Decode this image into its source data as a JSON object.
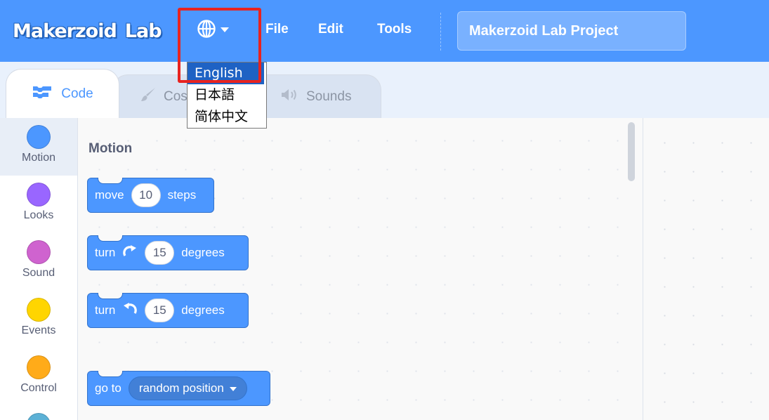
{
  "menubar": {
    "logo_text": "Makerzoid Lab",
    "logo_part1": "Makerzoid",
    "logo_part2": "Lab",
    "language_icon": "globe-icon",
    "file_label": "File",
    "edit_label": "Edit",
    "tools_label": "Tools",
    "project_title": "Makerzoid Lab Project"
  },
  "language_menu": {
    "options": [
      "English",
      "日本語",
      "简体中文"
    ],
    "selected": "English"
  },
  "tabs": [
    {
      "label": "Code",
      "icon": "code-blocks-icon",
      "active": true
    },
    {
      "label": "Costumes",
      "icon": "paintbrush-icon",
      "active": false
    },
    {
      "label": "Sounds",
      "icon": "speaker-icon",
      "active": false
    }
  ],
  "categories": [
    {
      "label": "Motion",
      "color": "#4c97ff",
      "active": true
    },
    {
      "label": "Looks",
      "color": "#9966ff",
      "active": false
    },
    {
      "label": "Sound",
      "color": "#cf63cf",
      "active": false
    },
    {
      "label": "Events",
      "color": "#ffd500",
      "active": false
    },
    {
      "label": "Control",
      "color": "#ffab19",
      "active": false
    }
  ],
  "flyout": {
    "heading": "Motion",
    "blocks": {
      "move": {
        "prefix": "move",
        "value": "10",
        "suffix": "steps"
      },
      "turn_right": {
        "prefix": "turn",
        "icon": "rotate-right-icon",
        "value": "15",
        "suffix": "degrees"
      },
      "turn_left": {
        "prefix": "turn",
        "icon": "rotate-left-icon",
        "value": "15",
        "suffix": "degrees"
      },
      "go_to": {
        "prefix": "go to",
        "dropdown": "random position"
      }
    }
  },
  "colors": {
    "menubar": "#4c97ff",
    "motion_block": "#4c97ff",
    "highlight": "#e8231f",
    "selected_option": "#1e62c4"
  }
}
